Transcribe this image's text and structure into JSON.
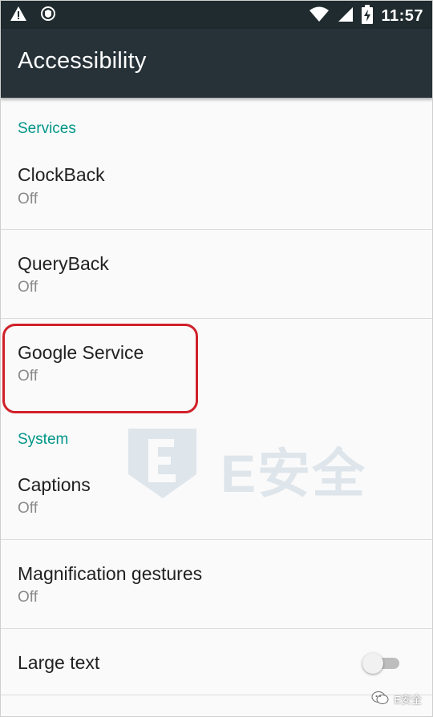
{
  "status_bar": {
    "time": "11:57"
  },
  "app_bar": {
    "title": "Accessibility"
  },
  "sections": {
    "services": {
      "header": "Services",
      "items": [
        {
          "title": "ClockBack",
          "status": "Off"
        },
        {
          "title": "QueryBack",
          "status": "Off"
        },
        {
          "title": "Google Service",
          "status": "Off"
        }
      ]
    },
    "system": {
      "header": "System",
      "items": [
        {
          "title": "Captions",
          "status": "Off"
        },
        {
          "title": "Magnification gestures",
          "status": "Off"
        },
        {
          "title": "Large text",
          "toggle": "off"
        }
      ]
    }
  },
  "watermark": {
    "text": "E安全"
  },
  "wechat_badge": {
    "text": "E安全"
  },
  "colors": {
    "accent": "#009688",
    "appbar": "#263238",
    "statusbar": "#1f2b2e",
    "highlight": "#d0202a"
  }
}
